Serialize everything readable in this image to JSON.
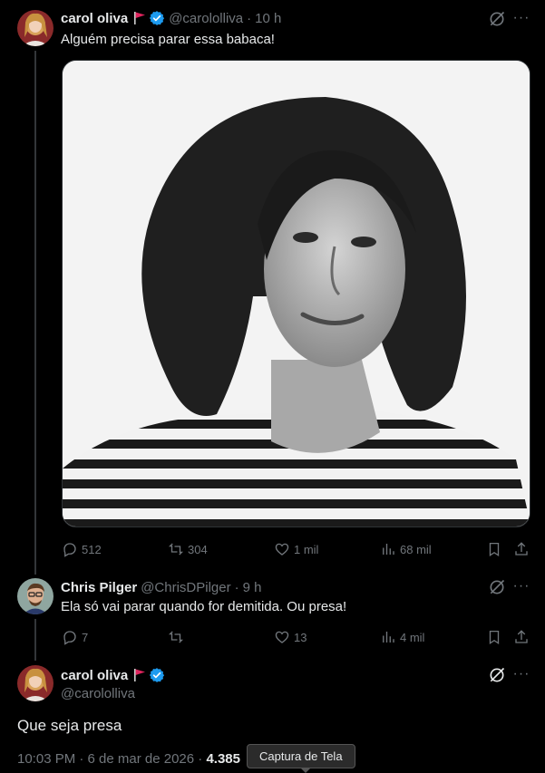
{
  "tweet1": {
    "name": "carol oliva",
    "handle": "@carololliva",
    "time": "10 h",
    "text": "Alguém precisa parar essa babaca!",
    "replies": "512",
    "retweets": "304",
    "likes": "1 mil",
    "views": "68 mil"
  },
  "tweet2": {
    "name": "Chris Pilger",
    "handle": "@ChrisDPilger",
    "time": "9 h",
    "text": "Ela só vai parar quando for demitida. Ou presa!",
    "replies": "7",
    "retweets": "",
    "likes": "13",
    "views": "4 mil"
  },
  "tweet3": {
    "name": "carol oliva",
    "handle": "@carololliva",
    "text": "Que seja presa",
    "timestamp": "10:03 PM · 6 de mar de 2026 ·",
    "views_count": "4.385"
  },
  "tooltip": "Captura de Tela",
  "separator": "·",
  "colors": {
    "background": "#000000",
    "text": "#e7e9ea",
    "muted": "#71767b",
    "verified": "#1d9bf0",
    "flag": "#e0245e"
  }
}
